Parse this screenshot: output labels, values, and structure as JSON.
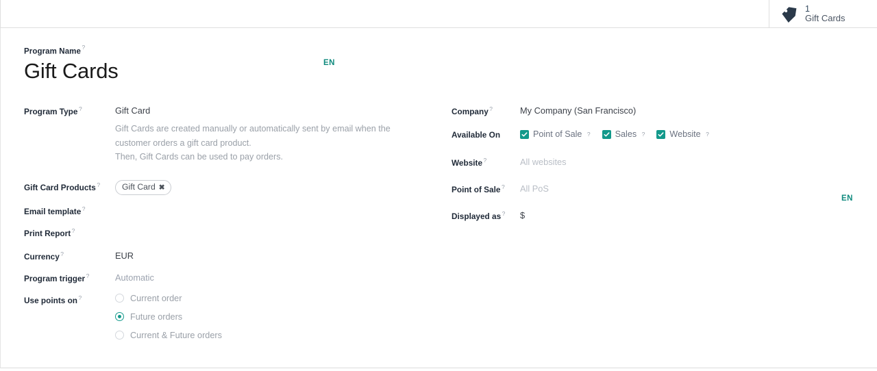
{
  "statbar": {
    "icon": "tag-icon",
    "value": "1",
    "label": "Gift Cards"
  },
  "title": {
    "label": "Program Name",
    "help": "?",
    "value": "Gift Cards",
    "lang_badge": "EN"
  },
  "left_column": {
    "program_type": {
      "label": "Program Type",
      "help": "?",
      "value": "Gift Card",
      "description_line1": "Gift Cards are created manually or automatically sent by email when the",
      "description_line2": "customer orders a gift card product.",
      "description_line3": "Then, Gift Cards can be used to pay orders."
    },
    "gift_card_products": {
      "label": "Gift Card Products",
      "help": "?",
      "chip_label": "Gift Card",
      "chip_remove": "✖"
    },
    "email_template": {
      "label": "Email template",
      "help": "?",
      "value": ""
    },
    "print_report": {
      "label": "Print Report",
      "help": "?",
      "value": ""
    },
    "currency": {
      "label": "Currency",
      "help": "?",
      "value": "EUR"
    },
    "program_trigger": {
      "label": "Program trigger",
      "help": "?",
      "value": "Automatic"
    },
    "use_points_on": {
      "label": "Use points on",
      "help": "?",
      "options": [
        {
          "label": "Current order",
          "selected": false
        },
        {
          "label": "Future orders",
          "selected": true
        },
        {
          "label": "Current & Future orders",
          "selected": false
        }
      ]
    }
  },
  "right_column": {
    "company": {
      "label": "Company",
      "help": "?",
      "value": "My Company (San Francisco)"
    },
    "available_on": {
      "label": "Available On",
      "options": [
        {
          "label": "Point of Sale",
          "help": "?",
          "checked": true
        },
        {
          "label": "Sales",
          "help": "?",
          "checked": true
        },
        {
          "label": "Website",
          "help": "?",
          "checked": true
        }
      ]
    },
    "website": {
      "label": "Website",
      "help": "?",
      "placeholder": "All websites"
    },
    "point_of_sale": {
      "label": "Point of Sale",
      "help": "?",
      "placeholder": "All PoS"
    },
    "displayed_as": {
      "label": "Displayed as",
      "help": "?",
      "value": "$",
      "lang_badge": "EN"
    }
  },
  "colors": {
    "accent_teal": "#13998b",
    "lang_teal": "#0f8a7e",
    "label_dark": "#1f2937",
    "muted_gray": "#9aa0a8",
    "placeholder_gray": "#b9bec6",
    "border_gray": "#dfdfdf",
    "icon_navy": "#2b3a4a"
  }
}
